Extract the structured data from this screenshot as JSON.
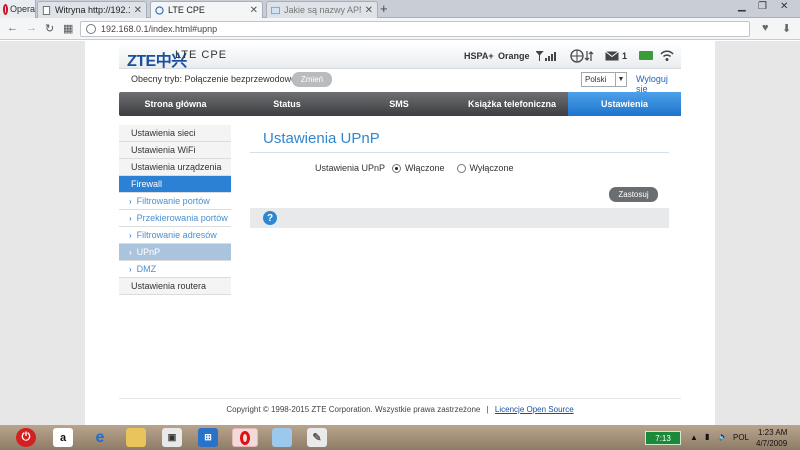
{
  "browser": {
    "opera_label": "Opera",
    "tabs": [
      {
        "label": "Witryna http://192.168.100",
        "active": false
      },
      {
        "label": "LTE CPE",
        "active": true
      },
      {
        "label": "Jakie są nazwy APN w sieci",
        "active": false
      }
    ],
    "url": "192.168.0.1/index.html#upnp"
  },
  "header": {
    "brand": "ZTE中兴",
    "product": "LTE CPE",
    "network_type": "HSPA+",
    "operator": "Orange",
    "sms_count": "1",
    "mode_text": "Obecny tryb: Połączenie bezprzewodowe",
    "change_label": "Zmień",
    "language": "Polski",
    "logout_label": "Wyloguj się"
  },
  "nav": {
    "items": [
      {
        "label": "Strona główna"
      },
      {
        "label": "Status"
      },
      {
        "label": "SMS"
      },
      {
        "label": "Książka telefoniczna"
      },
      {
        "label": "Ustawienia"
      }
    ],
    "active_index": 4
  },
  "sidebar": {
    "items": [
      {
        "label": "Ustawienia sieci",
        "type": "top"
      },
      {
        "label": "Ustawienia WiFi",
        "type": "top"
      },
      {
        "label": "Ustawienia urządzenia",
        "type": "top"
      },
      {
        "label": "Firewall",
        "type": "group-active"
      },
      {
        "label": "Filtrowanie portów",
        "type": "sub"
      },
      {
        "label": "Przekierowania portów",
        "type": "sub"
      },
      {
        "label": "Filtrowanie adresów",
        "type": "sub"
      },
      {
        "label": "UPnP",
        "type": "sub-selected"
      },
      {
        "label": "DMZ",
        "type": "sub"
      },
      {
        "label": "Ustawienia routera",
        "type": "top"
      }
    ]
  },
  "content": {
    "title": "Ustawienia UPnP",
    "field_label": "Ustawienia UPnP",
    "option_on": "Włączone",
    "option_off": "Wyłączone",
    "selected": "on",
    "apply_label": "Zastosuj",
    "help_symbol": "?"
  },
  "footer": {
    "copyright": "Copyright © 1998-2015 ZTE Corporation. Wszystkie prawa zastrzeżone",
    "separator": "|",
    "license_link": "Licencje Open Source"
  },
  "taskbar": {
    "tray_badge": "7:13",
    "language": "POL",
    "time": "1:23 AM",
    "date": "4/7/2009"
  },
  "colors": {
    "accent": "#2c81d4",
    "nav_dark": "#4a4c4f",
    "title_blue": "#2f87cf"
  }
}
